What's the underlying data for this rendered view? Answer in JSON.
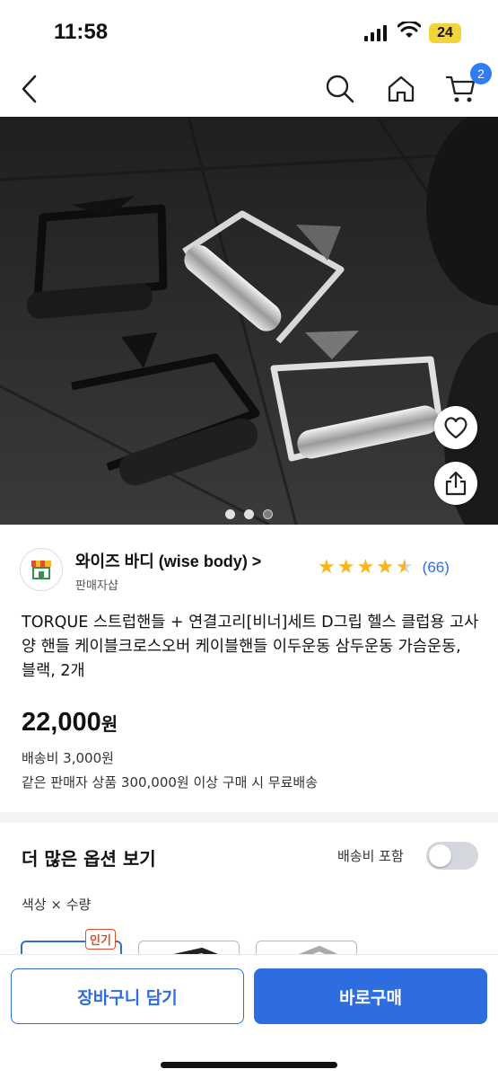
{
  "status": {
    "time": "11:58",
    "battery": "24"
  },
  "nav": {
    "cart_count": "2"
  },
  "seller": {
    "name": "와이즈 바디 (wise body) >",
    "sub": "판매자샵",
    "review_count": "(66)"
  },
  "product": {
    "title": "TORQUE 스트럽핸들 + 연결고리[비너]세트 D그립 헬스 클럽용 고사양 핸들 케이블크로스오버 케이블핸들 이두운동 삼두운동 가슴운동, 블랙, 2개",
    "price": "22,000",
    "price_unit": "원",
    "shipping": "배송비 3,000원",
    "free_shipping": "같은 판매자 상품 300,000원 이상 구매 시 무료배송"
  },
  "options": {
    "title": "더 많은 옵션 보기",
    "include_shipping_label": "배송비 포함",
    "include_shipping_on": false,
    "subtitle": "색상 × 수량",
    "popular_badge": "인기"
  },
  "actions": {
    "add_to_cart": "장바구니 담기",
    "buy_now": "바로구매"
  },
  "colors": {
    "accent": "#2e6de0",
    "star": "#f7b51e",
    "badge": "#e64d2e"
  },
  "rating": {
    "stars": 4.5,
    "max": 5
  },
  "gallery": {
    "current": 1,
    "total": 3
  },
  "icons": [
    "back-icon",
    "search-icon",
    "home-icon",
    "cart-icon",
    "heart-icon",
    "share-icon",
    "shop-icon",
    "star-icon"
  ]
}
